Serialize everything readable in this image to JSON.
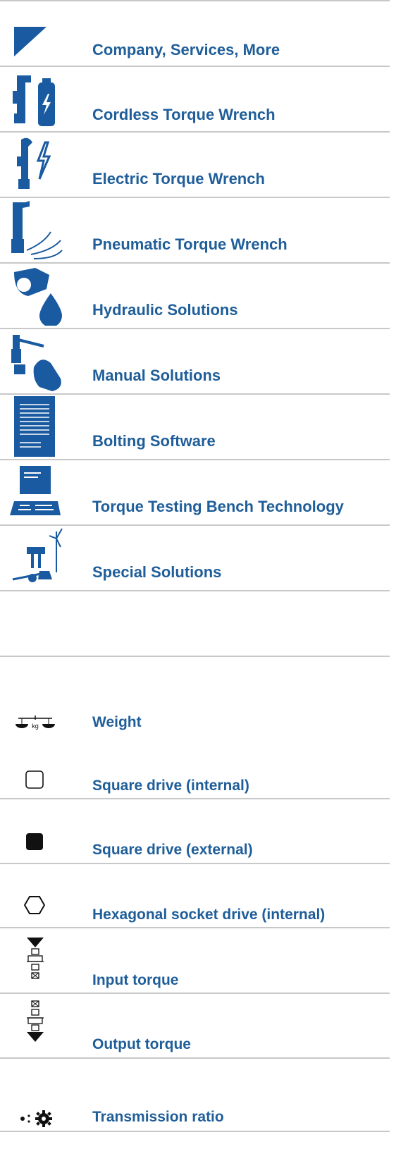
{
  "categories": [
    {
      "label": "Company, Services, More",
      "icon": "company-logo-icon"
    },
    {
      "label": "Cordless Torque Wrench",
      "icon": "cordless-wrench-icon"
    },
    {
      "label": "Electric Torque Wrench",
      "icon": "electric-wrench-icon"
    },
    {
      "label": "Pneumatic Torque Wrench",
      "icon": "pneumatic-wrench-icon"
    },
    {
      "label": "Hydraulic Solutions",
      "icon": "hydraulic-icon"
    },
    {
      "label": "Manual Solutions",
      "icon": "manual-icon"
    },
    {
      "label": "Bolting Software",
      "icon": "software-icon"
    },
    {
      "label": "Torque Testing Bench Technology",
      "icon": "testing-bench-icon"
    },
    {
      "label": "Special Solutions",
      "icon": "special-solutions-icon"
    }
  ],
  "legend": [
    {
      "label": "Weight",
      "icon": "weight-scale-icon"
    },
    {
      "label": "Square drive (internal)",
      "icon": "square-outline-icon"
    },
    {
      "label": "Square drive (external)",
      "icon": "square-filled-icon"
    },
    {
      "label": "Hexagonal socket drive (internal)",
      "icon": "hexagon-icon"
    },
    {
      "label": "Input torque",
      "icon": "input-torque-icon"
    },
    {
      "label": "Output torque",
      "icon": "output-torque-icon"
    },
    {
      "label": "Transmission ratio",
      "icon": "transmission-ratio-icon"
    }
  ],
  "weight_unit": "kg",
  "colors": {
    "accent": "#1f5e99",
    "icon_blue": "#1a5aa0",
    "divider": "#c8c8c8"
  }
}
